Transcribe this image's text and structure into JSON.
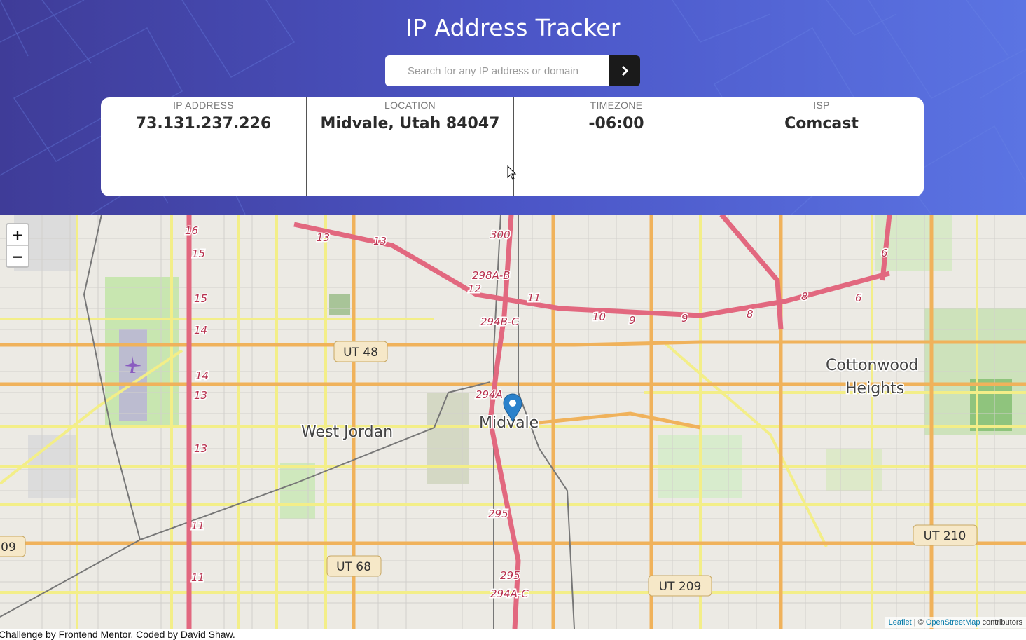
{
  "header": {
    "title": "IP Address Tracker"
  },
  "search": {
    "placeholder": "Search for any IP address or domain",
    "value": ""
  },
  "info": [
    {
      "label": "IP ADDRESS",
      "value": "73.131.237.226"
    },
    {
      "label": "LOCATION",
      "value": "Midvale, Utah 84047"
    },
    {
      "label": "TIMEZONE",
      "value": "-06:00"
    },
    {
      "label": "ISP",
      "value": "Comcast"
    }
  ],
  "map": {
    "zoom_in": "+",
    "zoom_out": "−",
    "places": {
      "west_jordan": "West Jordan",
      "midvale": "Midvale",
      "cottonwood_1": "Cottonwood",
      "cottonwood_2": "Heights"
    },
    "shields": [
      "UT 48",
      "UT 68",
      "UT 209",
      "UT 210",
      "09"
    ],
    "route_labels": [
      "16",
      "15",
      "15",
      "14",
      "14",
      "13",
      "13",
      "11",
      "11",
      "13",
      "13",
      "300",
      "298A-B",
      "12",
      "11",
      "294B-C",
      "294A",
      "10",
      "9",
      "9",
      "8",
      "8",
      "6",
      "6",
      "295",
      "295",
      "294A-C"
    ],
    "attribution": {
      "leaflet": "Leaflet",
      "sep": " | © ",
      "osm": "OpenStreetMap",
      "contributors": " contributors"
    }
  },
  "footer": {
    "text": "Challenge by Frontend Mentor. Coded by David Shaw."
  },
  "colors": {
    "gradient_start": "#3f3c98",
    "gradient_end": "#5b74e3",
    "dark": "#1a1a1a",
    "motorway": "#e2687f",
    "primary_road": "#f2b860",
    "secondary_road": "#f5f08a",
    "marker": "#2a81cb"
  }
}
